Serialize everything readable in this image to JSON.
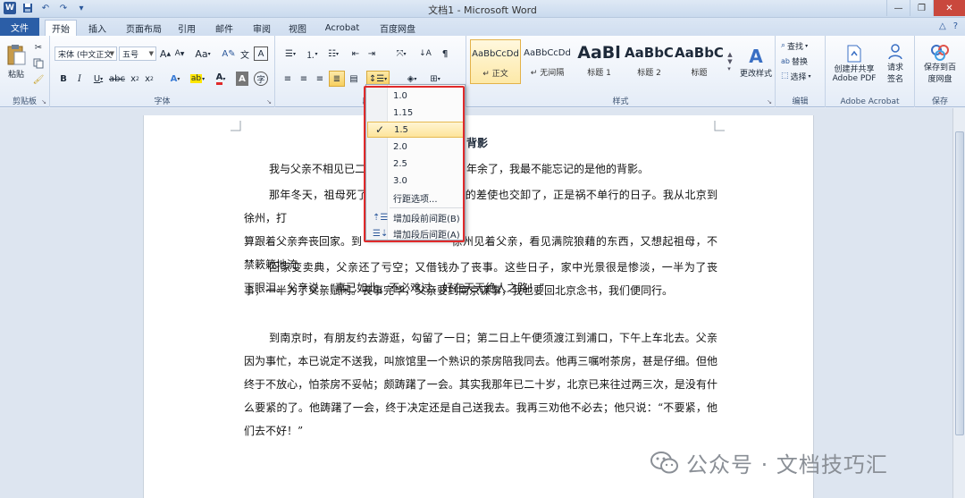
{
  "window": {
    "title": "文档1 - Microsoft Word",
    "logo_letter": "W"
  },
  "tabs": [
    {
      "label": "文件"
    },
    {
      "label": "开始"
    },
    {
      "label": "插入"
    },
    {
      "label": "页面布局"
    },
    {
      "label": "引用"
    },
    {
      "label": "邮件"
    },
    {
      "label": "审阅"
    },
    {
      "label": "视图"
    },
    {
      "label": "Acrobat"
    },
    {
      "label": "百度网盘"
    }
  ],
  "ribbon": {
    "clipboard": {
      "label": "剪贴板",
      "paste": "粘贴"
    },
    "font": {
      "label": "字体",
      "font_name": "宋体 (中文正文",
      "font_size": "五号"
    },
    "paragraph": {
      "label": "段落"
    },
    "styles": {
      "label": "样式",
      "items": [
        {
          "sample": "AaBbCcDd",
          "name": "↵ 正文"
        },
        {
          "sample": "AaBbCcDd",
          "name": "↵ 无间隔"
        },
        {
          "sample": "AaBl",
          "name": "标题 1"
        },
        {
          "sample": "AaBbC",
          "name": "标题 2"
        },
        {
          "sample": "AaBbC",
          "name": "标题"
        }
      ],
      "change_styles": "更改样式"
    },
    "editing": {
      "label": "编辑",
      "find": "查找",
      "replace": "替换",
      "select": "选择"
    },
    "acrobat": {
      "label": "Adobe Acrobat",
      "create_share": "创建并共享",
      "create_share_2": "Adobe PDF",
      "request": "请求",
      "request_2": "签名"
    },
    "save": {
      "label": "保存",
      "save_to": "保存到百",
      "save_to_2": "度网盘"
    }
  },
  "menu": {
    "items": [
      {
        "label": "1.0"
      },
      {
        "label": "1.15"
      },
      {
        "label": "1.5",
        "checked": true
      },
      {
        "label": "2.0"
      },
      {
        "label": "2.5"
      },
      {
        "label": "3.0"
      },
      {
        "label": "行距选项..."
      },
      {
        "label": "增加段前间距(B)"
      },
      {
        "label": "增加段后间距(A)"
      }
    ],
    "check_mark": "✓"
  },
  "document": {
    "title": "背影",
    "paragraphs": [
      "我与父亲不相见已二",
      "年余了，我最不能忘记的是他的背影。",
      "那年冬天，祖母死了",
      "，父亲的差使也交卸了，正是祸不单行的日子。我从北京到徐州，打",
      "算跟着父亲奔丧回家。到",
      "徐州见着父亲，看见满院狼藉的东西，又想起祖母，不禁簌簌地流",
      "下眼泪。父亲说：“事已如此，不必难过，好在天无绝人之路！”",
      "回家变卖典，父亲还了亏空；又借钱办了丧事。这些日子，家中光景很是惨淡，一半为了丧事，一半为了父亲赋闲。丧事完毕，父亲要到南京谋事，我也要回北京念书，我们便同行。",
      "到南京时，有朋友约去游逛，勾留了一日；第二日上午便须渡江到浦口，下午上车北去。父亲因为事忙，本已说定不送我，叫旅馆里一个熟识的茶房陪我同去。他再三嘱咐茶房，甚是仔细。但他终于不放心，怕茶房不妥帖；颇踌躇了一会。其实我那年已二十岁，北京已来往过两三次，是没有什么要紧的了。他踌躇了一会，终于决定还是自己送我去。我再三劝他不必去；他只说：“不要紧，他们去不好！”"
    ]
  },
  "watermark": {
    "text": "公众号 · 文档技巧汇"
  }
}
